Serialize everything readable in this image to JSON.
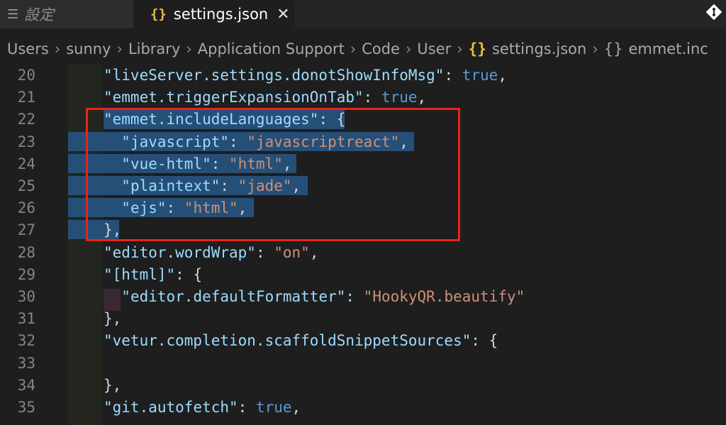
{
  "tabs": {
    "inactive": {
      "icon": "list-icon",
      "label": "設定"
    },
    "active": {
      "icon": "json-braces-icon",
      "label": "settings.json",
      "close": "✕"
    }
  },
  "breadcrumb": [
    "Users",
    "sunny",
    "Library",
    "Application Support",
    "Code",
    "User",
    "settings.json",
    "emmet.inc"
  ],
  "breadcrumb_icons": {
    "json": "{}",
    "object": "{}"
  },
  "lines": [
    {
      "n": "20",
      "key": "\"liveServer.settings.donotShowInfoMsg\"",
      "colon": ": ",
      "val": "true",
      "vtype": "b",
      "tail": ","
    },
    {
      "n": "21",
      "key": "\"emmet.triggerExpansionOnTab\"",
      "colon": ": ",
      "val": "true",
      "vtype": "b",
      "tail": ","
    },
    {
      "n": "22",
      "key": "\"emmet.includeLanguages\"",
      "colon": ": ",
      "val": "{",
      "vtype": "p",
      "tail": ""
    },
    {
      "n": "23",
      "key": "\"javascript\"",
      "colon": ": ",
      "val": "\"javascriptreact\"",
      "vtype": "s",
      "tail": ","
    },
    {
      "n": "24",
      "key": "\"vue-html\"",
      "colon": ": ",
      "val": "\"html\"",
      "vtype": "s",
      "tail": ","
    },
    {
      "n": "25",
      "key": "\"plaintext\"",
      "colon": ": ",
      "val": "\"jade\"",
      "vtype": "s",
      "tail": ","
    },
    {
      "n": "26",
      "key": "\"ejs\"",
      "colon": ": ",
      "val": "\"html\"",
      "vtype": "s",
      "tail": ","
    },
    {
      "n": "27",
      "key": "",
      "colon": "",
      "val": "},",
      "vtype": "p",
      "tail": ""
    },
    {
      "n": "28",
      "key": "\"editor.wordWrap\"",
      "colon": ": ",
      "val": "\"on\"",
      "vtype": "s",
      "tail": ","
    },
    {
      "n": "29",
      "key": "\"[html]\"",
      "colon": ": ",
      "val": "{",
      "vtype": "p",
      "tail": ""
    },
    {
      "n": "30",
      "key": "\"editor.defaultFormatter\"",
      "colon": ": ",
      "val": "\"HookyQR.beautify\"",
      "vtype": "s",
      "tail": ""
    },
    {
      "n": "31",
      "key": "",
      "colon": "",
      "val": "},",
      "vtype": "p",
      "tail": ""
    },
    {
      "n": "32",
      "key": "\"vetur.completion.scaffoldSnippetSources\"",
      "colon": ": ",
      "val": "{",
      "vtype": "p",
      "tail": ""
    },
    {
      "n": "33",
      "key": "",
      "colon": "",
      "val": "",
      "vtype": "p",
      "tail": ""
    },
    {
      "n": "34",
      "key": "",
      "colon": "",
      "val": "},",
      "vtype": "p",
      "tail": ""
    },
    {
      "n": "35",
      "key": "\"git.autofetch\"",
      "colon": ": ",
      "val": "true",
      "vtype": "b",
      "tail": ","
    }
  ],
  "indent_chars": [
    0,
    0,
    0,
    1,
    1,
    1,
    1,
    0,
    0,
    0,
    1,
    0,
    0,
    0,
    0,
    0
  ],
  "colors": {
    "key": "#9cdcfe",
    "string": "#ce9178",
    "boolean": "#569cd6",
    "highlight_box": "#e8231c",
    "selection": "#264f78"
  }
}
